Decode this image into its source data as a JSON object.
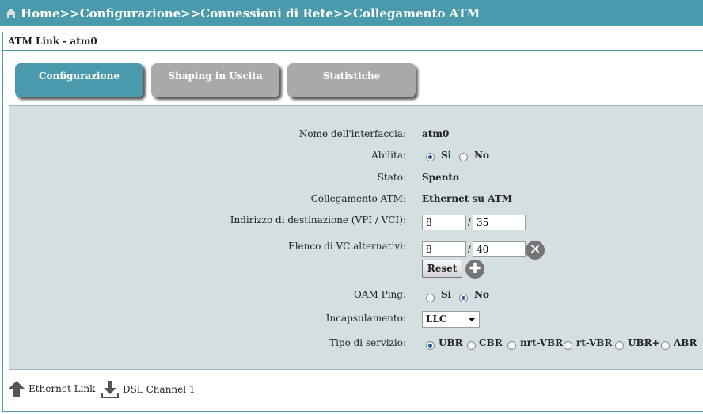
{
  "breadcrumb": "Home>>Configurazione>>Connessioni di Rete>>Collegamento ATM",
  "section_title": "ATM Link - atm0",
  "tabs": [
    {
      "label": "Configurazione",
      "active": true
    },
    {
      "label": "Shaping in Uscita",
      "active": false
    },
    {
      "label": "Statistiche",
      "active": false
    }
  ],
  "form": {
    "interface_name_label": "Nome dell'interfaccia:",
    "interface_name_value": "atm0",
    "enable_label": "Abilita:",
    "enable_yes": "Si",
    "enable_no": "No",
    "enable_selected": "Si",
    "status_label": "Stato:",
    "status_value": "Spento",
    "atm_link_label": "Collegamento ATM:",
    "atm_link_value": "Ethernet su ATM",
    "dest_label": "Indirizzo di destinazione (VPI / VCI):",
    "dest_vpi": "8",
    "dest_vci": "35",
    "alt_vc_label": "Elenco di VC alternativi:",
    "alt_vpi": "8",
    "alt_vci": "40",
    "separator": "/",
    "reset_label": "Reset",
    "oam_label": "OAM Ping:",
    "oam_yes": "Si",
    "oam_no": "No",
    "oam_selected": "No",
    "encap_label": "Incapsulamento:",
    "encap_value": "LLC",
    "service_label": "Tipo di servizio:",
    "service_options": [
      "UBR",
      "CBR",
      "nrt-VBR",
      "rt-VBR",
      "UBR+",
      "ABR"
    ],
    "service_selected": "UBR"
  },
  "footer": {
    "prev_label": "Ethernet Link",
    "next_label": "DSL Channel 1"
  },
  "colors": {
    "accent": "#4a9aab",
    "panel": "#d3dfe1",
    "inactive_tab": "#a9a9a9"
  }
}
